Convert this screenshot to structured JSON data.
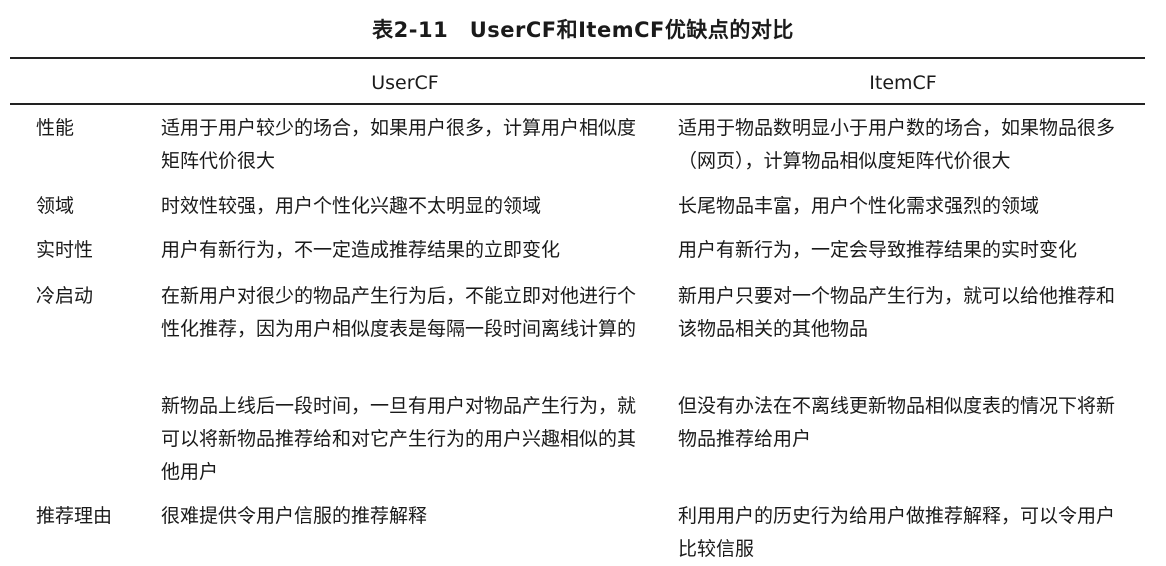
{
  "caption": "表2-11　UserCF和ItemCF优缺点的对比",
  "table": {
    "headers": [
      "",
      "UserCF",
      "ItemCF"
    ],
    "rows": [
      {
        "label": "性能",
        "usercf": "适用于用户较少的场合，如果用户很多，计算用户相似度矩阵代价很大",
        "itemcf": "适用于物品数明显小于用户数的场合，如果物品很多（网页），计算物品相似度矩阵代价很大"
      },
      {
        "label": "领域",
        "usercf": "时效性较强，用户个性化兴趣不太明显的领域",
        "itemcf": "长尾物品丰富，用户个性化需求强烈的领域"
      },
      {
        "label": "实时性",
        "usercf": "用户有新行为，不一定造成推荐结果的立即变化",
        "itemcf": "用户有新行为，一定会导致推荐结果的实时变化"
      },
      {
        "label": "冷启动",
        "usercf": "在新用户对很少的物品产生行为后，不能立即对他进行个性化推荐，因为用户相似度表是每隔一段时间离线计算的",
        "itemcf": "新用户只要对一个物品产生行为，就可以给他推荐和该物品相关的其他物品"
      },
      {
        "label": "",
        "usercf": "新物品上线后一段时间，一旦有用户对物品产生行为，就可以将新物品推荐给和对它产生行为的用户兴趣相似的其他用户",
        "itemcf": "但没有办法在不离线更新物品相似度表的情况下将新物品推荐给用户"
      },
      {
        "label": "推荐理由",
        "usercf": "很难提供令用户信服的推荐解释",
        "itemcf": "利用用户的历史行为给用户做推荐解释，可以令用户比较信服"
      }
    ]
  }
}
